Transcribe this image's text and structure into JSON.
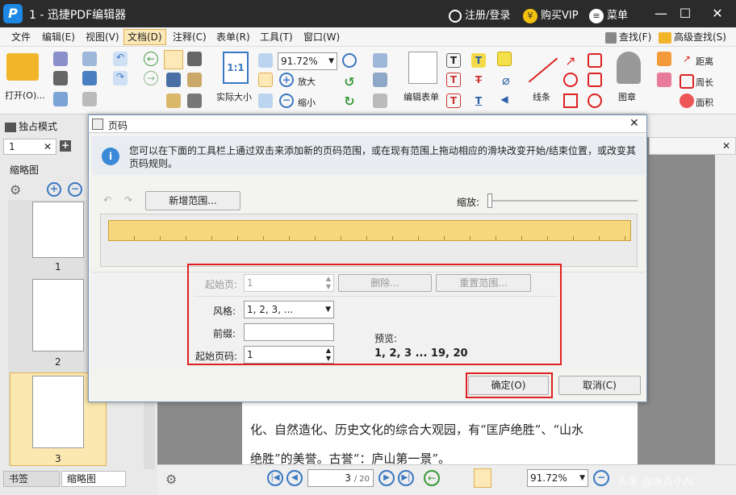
{
  "app": {
    "title": "1 - 迅捷PDF编辑器",
    "logo_letter": "P",
    "register": "注册/登录",
    "vip": "购买VIP",
    "menu": "菜单"
  },
  "menubar": [
    "文件",
    "编辑(E)",
    "视图(V)",
    "文档(D)",
    "注释(C)",
    "表单(R)",
    "工具(T)",
    "窗口(W)"
  ],
  "menubar_right": {
    "find": "查找(F)",
    "advanced_find": "高级查找(S)"
  },
  "ribbon": {
    "open": "打开(O)...",
    "actual_size": "实际大小",
    "zoom_value": "91.72%",
    "zoom_in": "放大",
    "zoom_out": "缩小",
    "edit_form": "编辑表单",
    "line": "线条",
    "stamp": "图章",
    "distance": "距离",
    "perimeter": "周长",
    "area": "面积"
  },
  "tabs": {
    "exclusive": "独占模式",
    "doc_tab": "1"
  },
  "left": {
    "thumbs_title": "缩略图",
    "pages": [
      "1",
      "2",
      "3"
    ],
    "bottom_tabs": [
      "书签",
      "缩略图"
    ]
  },
  "dialog": {
    "title": "页码",
    "info": "您可以在下面的工具栏上通过双击来添加新的页码范围，或在现有范围上拖动相应的滑块改变开始/结束位置，或改变其页码规则。",
    "add_range": "新增范围...",
    "zoom_label": "缩放:",
    "start_page_label": "起始页:",
    "start_page_value": "1",
    "delete": "删除...",
    "reset": "重置范围...",
    "style_label": "风格:",
    "style_value": "1, 2, 3, ...",
    "prefix_label": "前缀:",
    "prefix_value": "",
    "start_number_label": "起始页码:",
    "start_number_value": "1",
    "preview_label": "预览:",
    "preview_value": "1, 2, 3 ... 19, 20",
    "ok": "确定(O)",
    "cancel": "取消(C)"
  },
  "doc_text": [
    "化、自然造化、历史文化的综合大观园，有“匡庐绝胜”、“山水",
    "绝胜”的美誉。古誉“：庐山第一景”。"
  ],
  "statusbar": {
    "page_value": "3",
    "page_total": "/ 20",
    "zoom": "91.72%",
    "watermark": "头条 @冰点小AI"
  },
  "colors": {
    "titlebar": "#2b2b2b",
    "range_bar": "#f7d77b",
    "highlight_box": "#e02020"
  }
}
